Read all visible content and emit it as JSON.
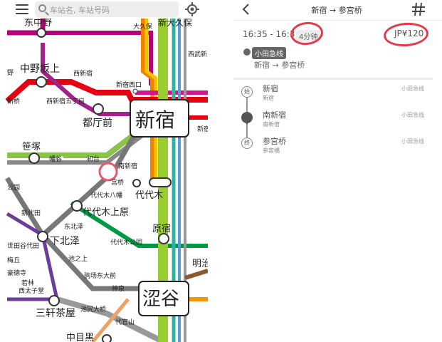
{
  "search": {
    "placeholder": "车站名, 车站号码"
  },
  "map": {
    "stations": {
      "higashi_nakano": "东中野",
      "okubo": "大久保",
      "shin_okubo": "新大久保",
      "seibu_shinjuku": "西武新",
      "nakano_sakaue": "中野坂上",
      "nishi_shinjuku": "西新宿",
      "shinjuku_nishiguchi": "新宿西口",
      "left_no": "野",
      "nishi_shinjuku_gochome": "西新宿五丁目",
      "shinbashi_left": "新桥",
      "tochomae": "都厅前",
      "shinjuku": "新宿",
      "sasazuka": "笹塚",
      "hatagaya": "幡谷",
      "hatsudai": "初台",
      "minami_shinjuku": "南新宿",
      "shinjuku_right": "新宿",
      "koen": "公园",
      "sangubashi": "宫桥",
      "yoyogi": "代代木",
      "yoyogi_hachiman": "代代木八幡",
      "shindaita": "新代田",
      "yoyogi_uehara": "代代木上原",
      "higashi_kitazawa": "东北泽",
      "harajuku": "原宿",
      "setagaya_daita": "世田谷代田",
      "shimokitazawa": "下北泽",
      "yoyogi_koen": "代代木公园",
      "ikenoue": "池之上",
      "meiji": "明治",
      "umegaoka": "梅丘",
      "gotokuji": "豪德寺",
      "komaba_todaimae": "驹场东大前",
      "wakabayashi": "若林",
      "nishitaishido": "西太子堂",
      "shinsen": "神泉",
      "shibuya": "涩谷",
      "sangenjaya": "三轩茶屋",
      "ikejiri_ohashi": "池尻大桥",
      "daikanyama": "代官山",
      "nakameguro": "中目黑"
    }
  },
  "detail": {
    "title": "新宿 → 参宫桥",
    "times": "16:35 - 16:3",
    "duration": "4分钟",
    "price": "JP¥120",
    "line_badge": "小田急线",
    "route_sub": "新宿 → 参宫桥",
    "stops": [
      {
        "marker": "始",
        "name": "新宿",
        "kana": "新宿",
        "line": "小田急线"
      },
      {
        "marker": "",
        "name": "南新宿",
        "kana": "南新宿",
        "line": "小田急线"
      },
      {
        "marker": "终",
        "name": "参宫桥",
        "kana": "参宫橋",
        "line": "小田急线"
      }
    ]
  },
  "colors": {
    "yamanote": "#9acd32",
    "marunouchi": "#e60012",
    "oedo": "#b6007a",
    "keio": "#dd0077",
    "odakyu": "#2288cc",
    "chiyoda": "#009944",
    "annotation": "#e53a4a"
  }
}
